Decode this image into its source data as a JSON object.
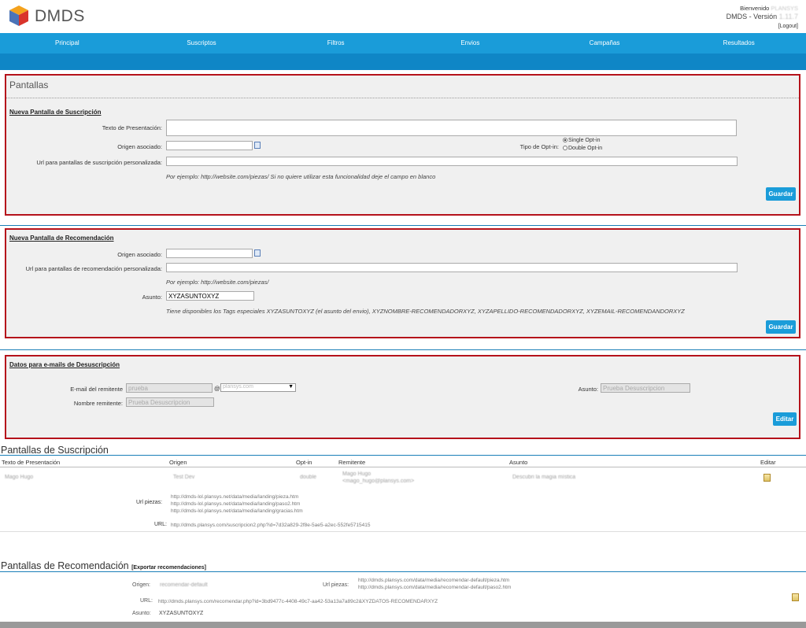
{
  "app": {
    "brand": "DMDS",
    "welcome_label": "Bienvenido",
    "welcome_user": "PLANSYS",
    "version_label": "DMDS - Versión",
    "version_value": "1.11.7",
    "logout": "[Logout]"
  },
  "nav": {
    "items": [
      "Principal",
      "Suscriptos",
      "Filtros",
      "Envios",
      "Campañas",
      "Resultados"
    ]
  },
  "pantallas": {
    "title": "Pantallas",
    "suscripcion": {
      "title": "Nueva Pantalla de Suscripción",
      "texto_label": "Texto de Presentación:",
      "origen_label": "Origen asociado:",
      "url_label": "Url para pantallas de suscripción personalizada:",
      "hint": "Por ejemplo: http://website.com/piezas/ Si no quiere utilizar esta funcionalidad deje el campo en blanco",
      "optin_label": "Tipo de Opt-in:",
      "optin_single": "Single Opt-in",
      "optin_double": "Double Opt-in",
      "save": "Guardar"
    },
    "recomendacion": {
      "title": "Nueva Pantalla de Recomendación",
      "origen_label": "Origen asociado:",
      "url_label": "Url para pantallas de recomendación personalizada:",
      "hint": "Por ejemplo: http://website.com/piezas/",
      "asunto_label": "Asunto:",
      "asunto_value": "XYZASUNTOXYZ",
      "tags_hint": "Tiene disponibles los Tags especiales XYZASUNTOXYZ (el asunto del envio), XYZNOMBRE-RECOMENDADORXYZ, XYZAPELLIDO-RECOMENDADORXYZ, XYZEMAIL-RECOMENDANDORXYZ",
      "save": "Guardar"
    },
    "desuscripcion": {
      "title": "Datos para e-mails de Desuscripción",
      "email_label": "E-mail del remitente",
      "email_user": "prueba",
      "at": "@",
      "domain": "plansys.com",
      "asunto_label": "Asunto:",
      "asunto_value": "Prueba Desuscripcion",
      "nombre_label": "Nombre remitente:",
      "nombre_value": "Prueba Desuscripcion",
      "edit": "Editar"
    }
  },
  "lista_suscripcion": {
    "title": "Pantallas de Suscripción",
    "headers": [
      "Texto de Presentación",
      "Origen",
      "Opt-in",
      "Remitente",
      "Asunto",
      "Editar"
    ],
    "row": {
      "texto": "Mago Hugo",
      "origen": "Test Dev",
      "optin": "double",
      "remitente_name": "Mago Hugo",
      "remitente_email": "<mago_hugo@plansys.com>",
      "asunto": "Descubri la magia mística",
      "url_piezas_label": "Url piezas:",
      "url_piezas": [
        "http://dmds-lol.plansys.net/data/media/landing/pieza.htm",
        "http://dmds-lol.plansys.net/data/media/landing/paso2.htm",
        "http://dmds-lol.plansys.net/data/media/landing/gracias.htm"
      ],
      "url_label": "URL:",
      "url": "http://dmds.plansys.com/suscripcion2.php?id=7d32a829-2f8e-5ae5-a2ec-552fe5715415"
    }
  },
  "lista_recomendacion": {
    "title": "Pantallas de Recomendación",
    "export": "[Exportar recomendaciones]",
    "origen_label": "Origen:",
    "origen_value": "recomendar-default",
    "url_piezas_label": "Url piezas:",
    "url_piezas": [
      "http://dmds.plansys.com/data/media/recomendar-default/pieza.htm",
      "http://dmds.plansys.com/data/media/recomendar-default/paso2.htm"
    ],
    "url_label": "URL:",
    "url": "http://dmds.plansys.com/recomendar.php?id=3bd9477c-4408-49c7-aa42-53a13a7a89c2&XYZDATOS-RECOMENDARXYZ",
    "asunto_label": "Asunto:",
    "asunto_value": "XYZASUNTOXYZ"
  },
  "colors": {
    "nav": "#1a9cd9",
    "subnav": "#0f86c6",
    "panel_border": "#b5121b",
    "button": "#1a9cd9"
  }
}
